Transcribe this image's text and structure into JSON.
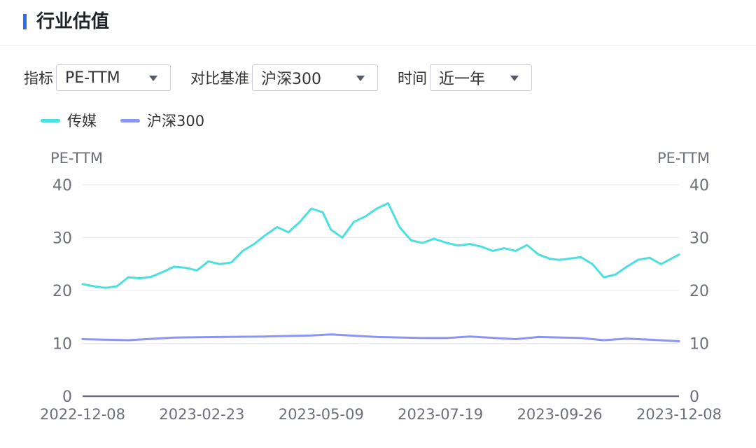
{
  "header": {
    "title": "行业估值"
  },
  "controls": {
    "indicator": {
      "label": "指标",
      "value": "PE-TTM"
    },
    "benchmark": {
      "label": "对比基准",
      "value": "沪深300"
    },
    "period": {
      "label": "时间",
      "value": "近一年"
    }
  },
  "colors": {
    "accent": "#2f6bea",
    "series1": "#4cdfe0",
    "series2": "#8a95f5",
    "grid": "#e8eaf0",
    "axis": "#6a6d80"
  },
  "chart_data": {
    "type": "line",
    "title": "",
    "y_left_label": "PE-TTM",
    "y_right_label": "PE-TTM",
    "ylim": [
      0,
      40
    ],
    "y_ticks": [
      "0",
      "10",
      "20",
      "30",
      "40"
    ],
    "x_ticks": [
      "2022-12-08",
      "2023-02-23",
      "2023-05-09",
      "2023-07-19",
      "2023-09-26",
      "2023-12-08"
    ],
    "x_range": [
      "2022-12-08",
      "2023-12-08"
    ],
    "legend_position": "top-left",
    "grid": true,
    "series": [
      {
        "name": "传媒",
        "x": [
          "2022-12-08",
          "2022-12-15",
          "2022-12-22",
          "2022-12-29",
          "2023-01-05",
          "2023-01-12",
          "2023-01-19",
          "2023-01-26",
          "2023-02-02",
          "2023-02-09",
          "2023-02-16",
          "2023-02-23",
          "2023-03-02",
          "2023-03-09",
          "2023-03-16",
          "2023-03-23",
          "2023-03-30",
          "2023-04-06",
          "2023-04-13",
          "2023-04-20",
          "2023-04-27",
          "2023-05-04",
          "2023-05-09",
          "2023-05-16",
          "2023-05-23",
          "2023-05-30",
          "2023-06-06",
          "2023-06-13",
          "2023-06-20",
          "2023-06-27",
          "2023-07-04",
          "2023-07-11",
          "2023-07-19",
          "2023-07-26",
          "2023-08-02",
          "2023-08-09",
          "2023-08-16",
          "2023-08-23",
          "2023-08-30",
          "2023-09-06",
          "2023-09-13",
          "2023-09-20",
          "2023-09-26",
          "2023-10-09",
          "2023-10-16",
          "2023-10-23",
          "2023-10-30",
          "2023-11-06",
          "2023-11-13",
          "2023-11-20",
          "2023-11-27",
          "2023-12-08"
        ],
        "values": [
          21.2,
          20.8,
          20.5,
          20.8,
          22.5,
          22.3,
          22.6,
          23.5,
          24.5,
          24.3,
          23.8,
          25.5,
          25.0,
          25.3,
          27.5,
          28.8,
          30.5,
          32.0,
          31.0,
          33.0,
          35.5,
          34.8,
          31.5,
          30.0,
          33.0,
          34.0,
          35.5,
          36.5,
          32.0,
          29.5,
          29.0,
          29.8,
          29.0,
          28.5,
          28.8,
          28.3,
          27.5,
          28.0,
          27.5,
          28.6,
          26.8,
          26.0,
          25.8,
          26.3,
          25.0,
          22.5,
          23.0,
          24.5,
          25.8,
          26.2,
          25.0,
          26.8
        ]
      },
      {
        "name": "沪深300",
        "x": [
          "2022-12-08",
          "2023-01-05",
          "2023-02-02",
          "2023-03-02",
          "2023-03-30",
          "2023-04-27",
          "2023-05-09",
          "2023-06-06",
          "2023-07-04",
          "2023-07-19",
          "2023-08-02",
          "2023-08-30",
          "2023-09-13",
          "2023-10-09",
          "2023-10-23",
          "2023-11-06",
          "2023-11-20",
          "2023-12-08"
        ],
        "values": [
          10.8,
          10.6,
          11.1,
          11.2,
          11.3,
          11.5,
          11.7,
          11.2,
          11.0,
          11.0,
          11.3,
          10.8,
          11.2,
          11.0,
          10.6,
          10.9,
          10.7,
          10.4
        ]
      }
    ]
  }
}
